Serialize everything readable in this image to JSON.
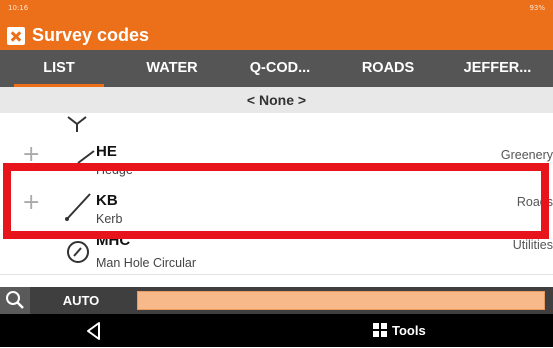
{
  "status_bar": {
    "time": "10:16",
    "battery": "93%"
  },
  "app": {
    "title": "Survey codes"
  },
  "tabs": [
    {
      "label": "LIST"
    },
    {
      "label": "WATER"
    },
    {
      "label": "Q-COD..."
    },
    {
      "label": "ROADS"
    },
    {
      "label": "JEFFER..."
    }
  ],
  "filter": {
    "value": "< None >"
  },
  "list": {
    "items": [
      {
        "code": "HE",
        "description": "Hedge",
        "category": "Greenery"
      },
      {
        "code": "KB",
        "description": "Kerb",
        "category": "Roads"
      },
      {
        "code": "MHC",
        "description": "Man Hole Circular",
        "category": "Utilities"
      }
    ]
  },
  "bottom_bar": {
    "auto_label": "AUTO",
    "input_value": ""
  },
  "nav": {
    "tools_label": "Tools"
  },
  "colors": {
    "accent": "#ec6f1a",
    "tab_bar": "#555555",
    "highlight": "#e8141b",
    "input": "#f7b98a"
  }
}
